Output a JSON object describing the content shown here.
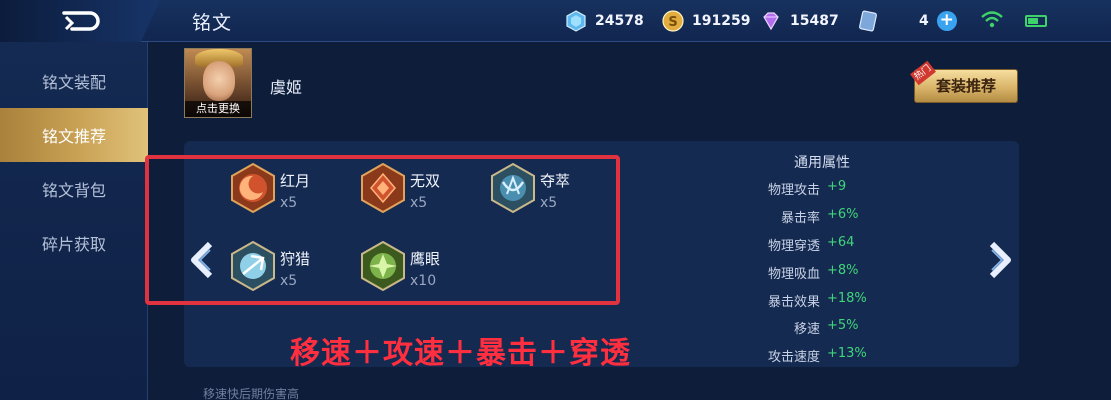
{
  "header": {
    "title": "铭文",
    "currencies": [
      {
        "name": "crystal",
        "value": "24578",
        "color": "#6fc6f5"
      },
      {
        "name": "gold",
        "value": "191259",
        "color": "#e7b74c"
      },
      {
        "name": "diamond",
        "value": "15487",
        "color": "#c285f2"
      },
      {
        "name": "ticket",
        "value": "4",
        "color": "#8db4ea"
      }
    ]
  },
  "sidebar": {
    "items": [
      {
        "label": "铭文装配",
        "active": false
      },
      {
        "label": "铭文推荐",
        "active": true
      },
      {
        "label": "铭文背包",
        "active": false
      },
      {
        "label": "碎片获取",
        "active": false
      }
    ]
  },
  "hero": {
    "name": "虞姬",
    "change_label": "点击更换"
  },
  "suit_button": {
    "label": "套装推荐",
    "tag": "热门"
  },
  "runes": [
    {
      "name": "红月",
      "count": "x5",
      "color": "#d2563a"
    },
    {
      "name": "无双",
      "count": "x5",
      "color": "#d2563a"
    },
    {
      "name": "夺萃",
      "count": "x5",
      "color": "#4a8fb0"
    },
    {
      "name": "狩猎",
      "count": "x5",
      "color": "#4a8fb0"
    },
    {
      "name": "鹰眼",
      "count": "x10",
      "color": "#7db34a"
    }
  ],
  "attributes": {
    "title": "通用属性",
    "rows": [
      {
        "name": "物理攻击",
        "value": "+9"
      },
      {
        "name": "暴击率",
        "value": "+6%"
      },
      {
        "name": "物理穿透",
        "value": "+64"
      },
      {
        "name": "物理吸血",
        "value": "+8%"
      },
      {
        "name": "暴击效果",
        "value": "+18%"
      },
      {
        "name": "移速",
        "value": "+5%"
      },
      {
        "name": "攻击速度",
        "value": "+13%"
      }
    ]
  },
  "overlay_text": "移速＋攻速＋暴击＋穿透",
  "footnote": "移速快后期伤害高",
  "colors": {
    "highlight": "#e0333f",
    "positive": "#3fd57a",
    "accent_gold": "#caa356"
  }
}
